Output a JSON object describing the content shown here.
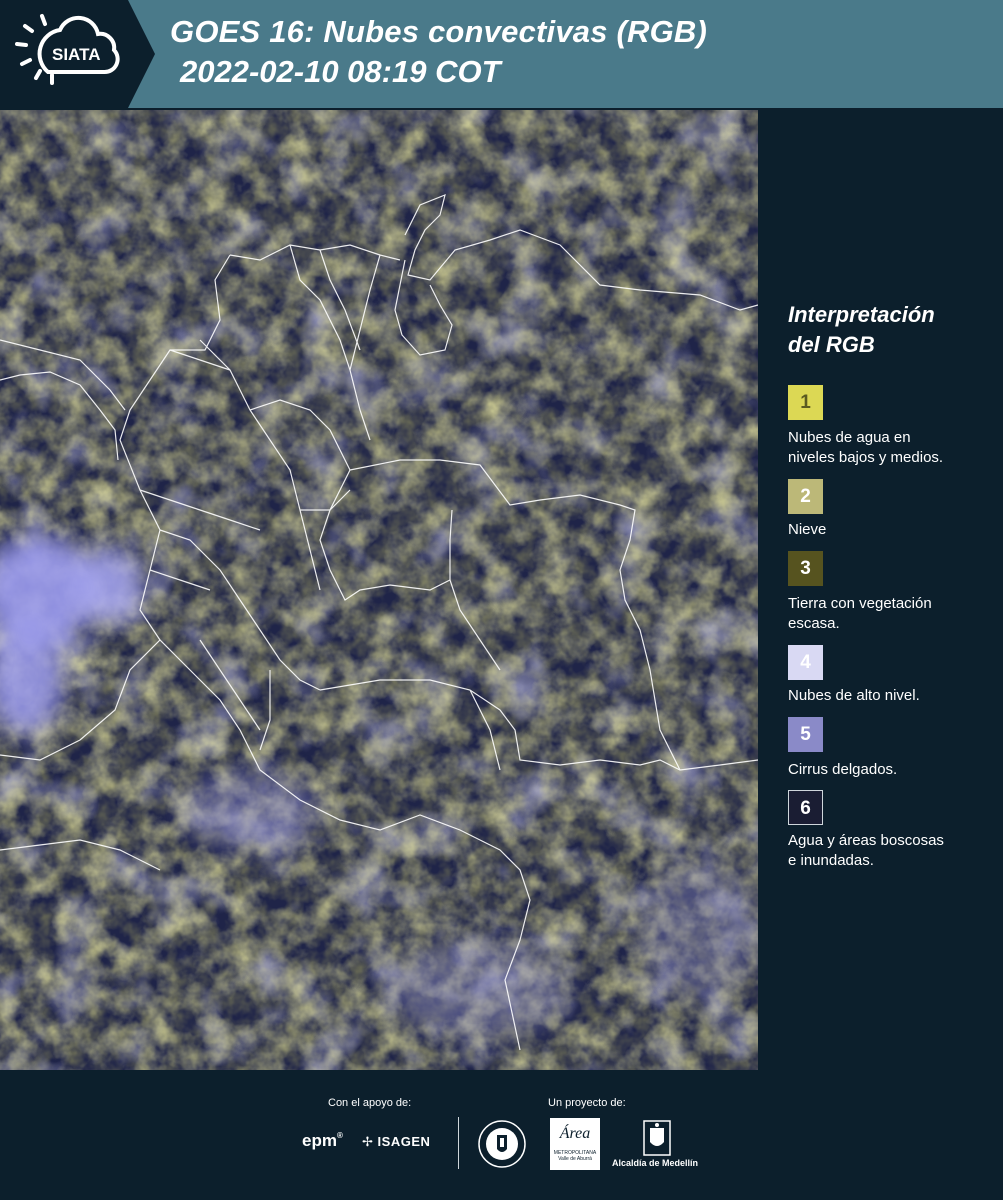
{
  "header": {
    "logo_text": "SIATA",
    "title_line1": "GOES 16: Nubes convectivas (RGB)",
    "title_line2": "2022-02-10 08:19 COT"
  },
  "legend": {
    "title_line1": "Interpretación",
    "title_line2": "del RGB",
    "items": [
      {
        "number": "1",
        "color": "#dcd854",
        "text_color": "#5a5a20",
        "lines": [
          "Nubes de agua en",
          "niveles bajos y medios."
        ]
      },
      {
        "number": "2",
        "color": "#bcb878",
        "text_color": "#ffffff",
        "lines": [
          "Nieve"
        ]
      },
      {
        "number": "3",
        "color": "#56531f",
        "text_color": "#ffffff",
        "lines": [
          "Tierra con vegetación",
          "escasa."
        ]
      },
      {
        "number": "4",
        "color": "#d9d9f3",
        "text_color": "#ffffff",
        "lines": [
          "Nubes de alto nivel."
        ]
      },
      {
        "number": "5",
        "color": "#8a8ac8",
        "text_color": "#ffffff",
        "lines": [
          "Cirrus delgados."
        ]
      },
      {
        "number": "6",
        "color": "#1a1d33",
        "text_color": "#ffffff",
        "lines": [
          "Agua y áreas boscosas",
          "e inundadas."
        ]
      }
    ]
  },
  "footer": {
    "support_label": "Con el apoyo de:",
    "project_label": "Un proyecto de:",
    "epm_logo": "epm",
    "isagen_logo": "ISAGEN",
    "area_logo": "Área",
    "area_sub1": "METROPOLITANA",
    "area_sub2": "Valle de Aburrá",
    "alcaldia_logo": "Alcaldía de Medellín"
  },
  "colors": {
    "header_bg": "#4a7a8a",
    "logo_bg": "#0c1f2c",
    "page_bg": "#0c1f2c",
    "map_water": "#1d2147"
  }
}
